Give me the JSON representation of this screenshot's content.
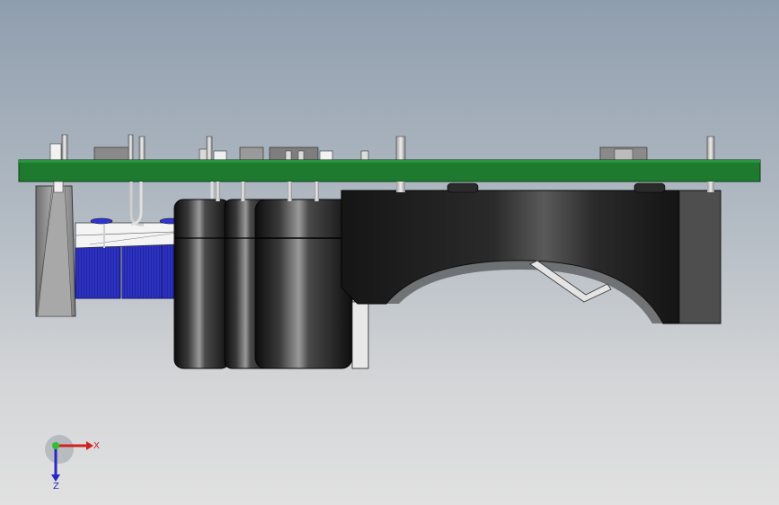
{
  "viewport": {
    "background_top": "#8f9eae",
    "background_bottom": "#e1e1e1"
  },
  "model": {
    "pcb_color": "#1d7a2f",
    "body_color": "#1a1a1a",
    "coil_color": "#2e34d6",
    "capacitor_color": "#1c1c1c"
  },
  "triad": {
    "x_label": "X",
    "z_label": "Z",
    "x_color": "#d22020",
    "y_color": "#2fbf2f",
    "z_color": "#2828c8"
  }
}
